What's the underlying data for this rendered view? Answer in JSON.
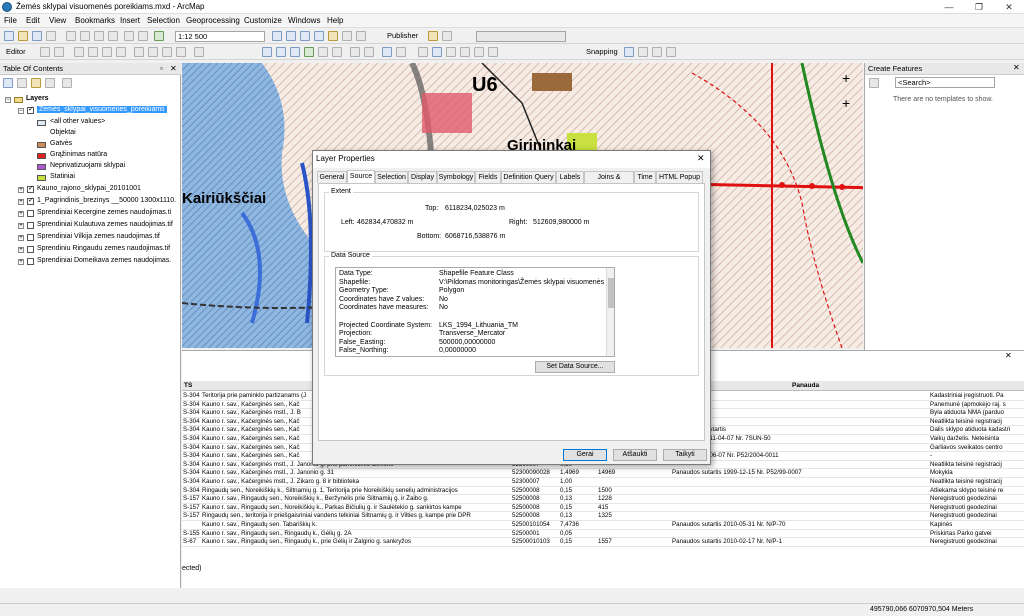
{
  "window": {
    "title": "Žemės sklypai visuomenės poreikiams.mxd - ArcMap"
  },
  "menu": [
    "File",
    "Edit",
    "View",
    "Bookmarks",
    "Insert",
    "Selection",
    "Geoprocessing",
    "Customize",
    "Windows",
    "Help"
  ],
  "toolbar": {
    "scale": "1:12 500",
    "publisher": "Publisher",
    "editor": "Editor",
    "snapping": "Snapping"
  },
  "toc": {
    "title": "Table Of Contents",
    "root": "Layers",
    "layer_selected": "Žemės_sklypai_visuomenės_poreikiams",
    "legend": [
      {
        "label": "<all other values>",
        "color": "#dfe9f5"
      },
      {
        "label": "Objektai",
        "color": ""
      },
      {
        "label": "Gatvės",
        "color": "#c98c59"
      },
      {
        "label": "Grąžinimas natūra",
        "color": "#e02020"
      },
      {
        "label": "Neprivatizuojami sklypai",
        "color": "#b05ad0"
      },
      {
        "label": "Statiniai",
        "color": "#c8e040"
      }
    ],
    "layers": [
      {
        "label": "Kauno_rajono_sklypai_20101001",
        "checked": true
      },
      {
        "label": "1_Pagrindinis_brezinys __50000 1300x1110.",
        "checked": true
      },
      {
        "label": "Sprendiniai Kecergine zemes naudojimas.ti",
        "checked": false
      },
      {
        "label": "Sprendiniai Kulautuva zemes naudojimas.tif",
        "checked": false
      },
      {
        "label": "Sprendiniai Vilkija zemes naudojimas.tif",
        "checked": false
      },
      {
        "label": "Sprendiniu Ringaudu zemes naudojimas.tif",
        "checked": false
      },
      {
        "label": "Sprendiniai Domeikava zemes naudojimas.",
        "checked": false
      }
    ]
  },
  "map": {
    "labels": [
      "U6",
      "Girininkai",
      "Kairiūkščiai"
    ]
  },
  "create_features": {
    "title": "Create Features",
    "search_placeholder": "<Search>",
    "empty": "There are no templates to show."
  },
  "dialog": {
    "title": "Layer Properties",
    "tabs": [
      "General",
      "Source",
      "Selection",
      "Display",
      "Symbology",
      "Fields",
      "Definition Query",
      "Labels",
      "Joins & Relates",
      "Time",
      "HTML Popup"
    ],
    "active_tab": "Source",
    "extent_title": "Extent",
    "top_label": "Top:",
    "top_value": "6118234,025023 m",
    "left_label": "Left:",
    "left_value": "462834,470832 m",
    "right_label": "Right:",
    "right_value": "512609,980000 m",
    "bottom_label": "Bottom:",
    "bottom_value": "6068716,538876 m",
    "datasource_title": "Data Source",
    "ds_rows": [
      {
        "k": "Data Type:",
        "v": "Shapefile Feature Class"
      },
      {
        "k": "Shapefile:",
        "v": "V:\\Pildomas monitoringas\\Žemės sklypai visuomenės por"
      },
      {
        "k": "Geometry Type:",
        "v": "Polygon"
      },
      {
        "k": "Coordinates have Z values:",
        "v": "No"
      },
      {
        "k": "Coordinates have measures:",
        "v": "No"
      },
      {
        "k": "",
        "v": ""
      },
      {
        "k": "Projected Coordinate System:",
        "v": "LKS_1994_Lithuania_TM"
      },
      {
        "k": "Projection:",
        "v": "Transverse_Mercator"
      },
      {
        "k": "False_Easting:",
        "v": "500000,00000000"
      },
      {
        "k": "False_Northing:",
        "v": "0,00000000"
      }
    ],
    "set_data_source": "Set Data Source...",
    "ok": "Gerai",
    "cancel": "Atšaukti",
    "apply": "Taikyti"
  },
  "table": {
    "col_ts": "TS",
    "col_panauda": "Panauda",
    "rows": [
      {
        "ts": "S-304",
        "addr": "Teritorija prie paminklo partizanams (J",
        "code": "",
        "n1": "",
        "n2": "",
        "note": "",
        "pan": "Kadastriniai įregistruoti. Pa"
      },
      {
        "ts": "S-304",
        "addr": "Kauno r. sav., Kačerginės sen., Kač",
        "code": "",
        "n1": "",
        "n2": "",
        "note": "",
        "pan": "Panemunė (apmokėjo raj. s"
      },
      {
        "ts": "S-304",
        "addr": "Kauno r. sav., Kačerginės mstl., J. B",
        "code": "",
        "n1": "",
        "n2": "",
        "note": "",
        "pan": "Byla atiduota NMA (parduo"
      },
      {
        "ts": "S-304",
        "addr": "Kauno r. sav., Kačerginės sen., Kač",
        "code": "",
        "n1": "",
        "n2": "",
        "note": "",
        "pan": "Neatlikta teisinė registracij"
      },
      {
        "ts": "S-304",
        "addr": "Kauno r. sav., Kačerginės sen., Kač",
        "code": "",
        "n1": "",
        "n2": "",
        "note": "a panaudos sutartis",
        "pan": "Dalis sklypo atiduota kadastri"
      },
      {
        "ts": "S-304",
        "addr": "Kauno r. sav., Kačerginės sen., Kač",
        "code": "",
        "n1": "",
        "n2": "",
        "note": "a sudaryta 2011-04-07 Nr. 7SUN-50",
        "pan": "Vaikų darželis. Neteisinta"
      },
      {
        "ts": "S-304",
        "addr": "Kauno r. sav., Kačerginės sen., Kač",
        "code": "",
        "n1": "",
        "n2": "",
        "note": "",
        "pan": "Garliavos sveikatos centro"
      },
      {
        "ts": "S-304",
        "addr": "Kauno r. sav., Kačerginės sen., Kač",
        "code": "",
        "n1": "",
        "n2": "",
        "note": "sutartis 2004-06-07 Nr. P52/2004-0011",
        "pan": "-"
      },
      {
        "ts": "S-304",
        "addr": "Kauno r. sav., Kačerginės mstl., J. Janonio g. prie paminklinio akmens",
        "code": "52300007",
        "n1": "0,10",
        "n2": "",
        "note": "",
        "pan": "Neatlikta teisinė registracij"
      },
      {
        "ts": "S-304",
        "addr": "Kauno r. sav., Kačerginės mstl., J. Janonio g. 31",
        "code": "52300090028",
        "n1": "1,4969",
        "n2": "14969",
        "note": "Panaudos sutartis 1999-12-15 Nr. P52/99-0007",
        "pan": "Mokykla"
      },
      {
        "ts": "S-304",
        "addr": "Kauno r. sav., Kačerginės mstl., J. Zikaro g. 8 ir biblioteka",
        "code": "52300007",
        "n1": "1,00",
        "n2": "",
        "note": "",
        "pan": "Neatlikta teisinė registracij"
      },
      {
        "ts": "S-304",
        "addr": "Ringaudų sen., Noreikiškių k., Šiltnamių g. 1, Teritorija prie Noreikiškių senelių administracijos",
        "code": "52500008",
        "n1": "0,15",
        "n2": "1500",
        "note": "",
        "pan": "Atliekama sklypo teisinė re"
      },
      {
        "ts": "S-157",
        "addr": "Kauno r. sav., Ringaudų sen., Noreikiškių k., Beržynėlis prie Šiltnamių g. ir Žaibo g.",
        "code": "52500008",
        "n1": "0,13",
        "n2": "1228",
        "note": "",
        "pan": "Neregistruoti geodezinai"
      },
      {
        "ts": "S-157",
        "addr": "Kauno r. sav., Ringaudų sen., Noreikiškių k., Parkas Bičiulių g. ir Saulėtekio g. sankirtos kampe",
        "code": "52500008",
        "n1": "0,15",
        "n2": "415",
        "note": "",
        "pan": "Neregistruoti geodezinai"
      },
      {
        "ts": "S-157",
        "addr": "Ringaudų sen., teritorija ir priešgaisriniai vandens telkiniai Šiltnamių g. ir Vilties g. kampe prie DPR",
        "code": "52500008",
        "n1": "0,13",
        "n2": "1325",
        "note": "",
        "pan": "Neregistruoti geodezinai"
      },
      {
        "ts": "",
        "addr": "Kauno r. sav., Ringaudų sen. Tabariškių k.",
        "code": "52500101054",
        "n1": "7,4736",
        "n2": "",
        "note": "Panaudos sutartis 2010-05-31 Nr. N/P-70",
        "pan": "Kapinės"
      },
      {
        "ts": "S-155",
        "addr": "Kauno r. sav., Ringaudų sen., Ringaudų k., Gėlių g. 2A",
        "code": "52500001",
        "n1": "0,05",
        "n2": "",
        "note": "",
        "pan": "Priskirtas Parko gatvei"
      },
      {
        "ts": "S-67",
        "addr": "Kauno r. sav., Ringaudų sen., Ringaudų k., prie Gėlių ir Žalgirio g. sankryžos",
        "code": "52500010103",
        "n1": "0,15",
        "n2": "1557",
        "note": "Panaudos sutartis 2010-02-17 Nr. N/P-1",
        "pan": "Neregistruoti geodezinai"
      }
    ],
    "footer": "ected)"
  },
  "status": {
    "coords": "495790,066  6070970,504 Meters"
  }
}
